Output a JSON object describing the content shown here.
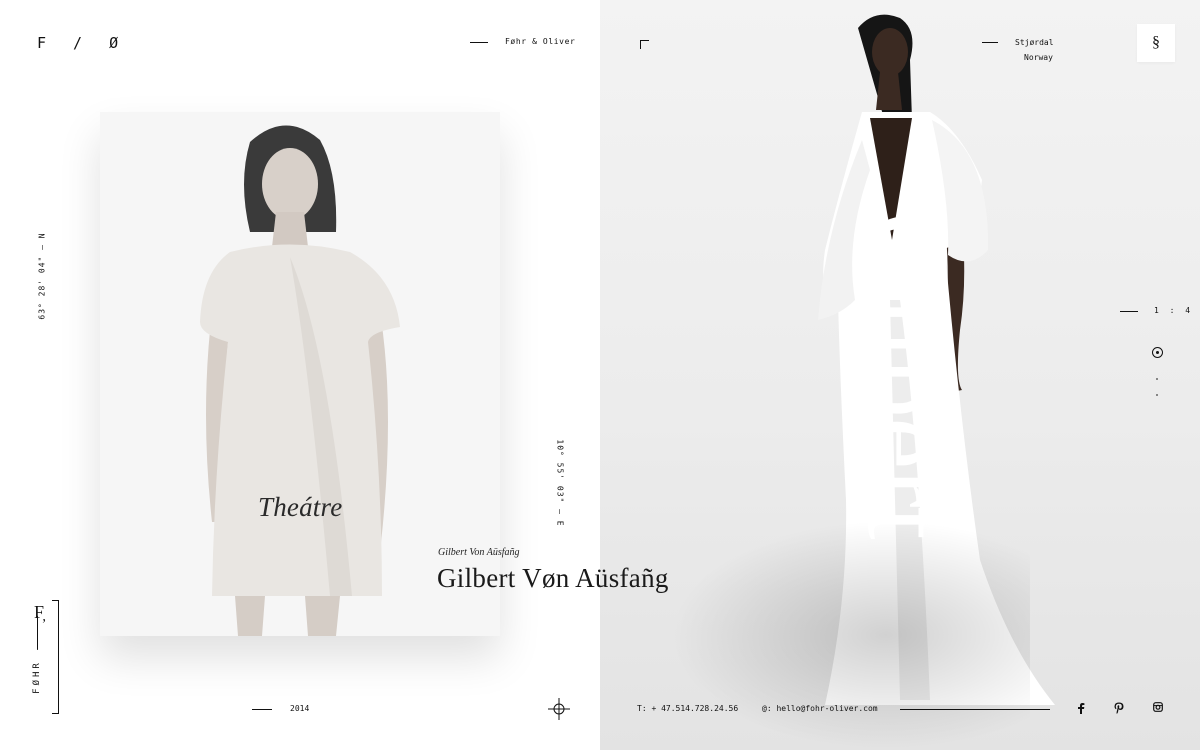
{
  "header": {
    "logo": "F / Ø",
    "brand_name": "Føhr & Oliver",
    "location_city": "Stjørdal",
    "location_country": "Norway",
    "menu_glyph": "§"
  },
  "coordinates": {
    "north": "63° 28' 04\" — N",
    "east": "10° 55' 03\" — E"
  },
  "side_brand": {
    "text": "FØHR",
    "glyph": "F̦"
  },
  "titles": {
    "theatre": "Theátre",
    "subtitle_small": "Gilbert Von Aüsfañg",
    "title_large": "Gilbert Vøn Aüsfañg",
    "gilbert_big": "Gilbert"
  },
  "slider": {
    "counter": "1 : 4"
  },
  "footer": {
    "year": "2014",
    "phone": "T: + 47.514.728.24.56",
    "email": "@: hello@fohr-oliver.com"
  },
  "social": [
    "facebook-icon",
    "pinterest-icon",
    "instagram-icon"
  ],
  "colors": {
    "text": "#111111",
    "panel": "#ececec",
    "background": "#ffffff"
  }
}
